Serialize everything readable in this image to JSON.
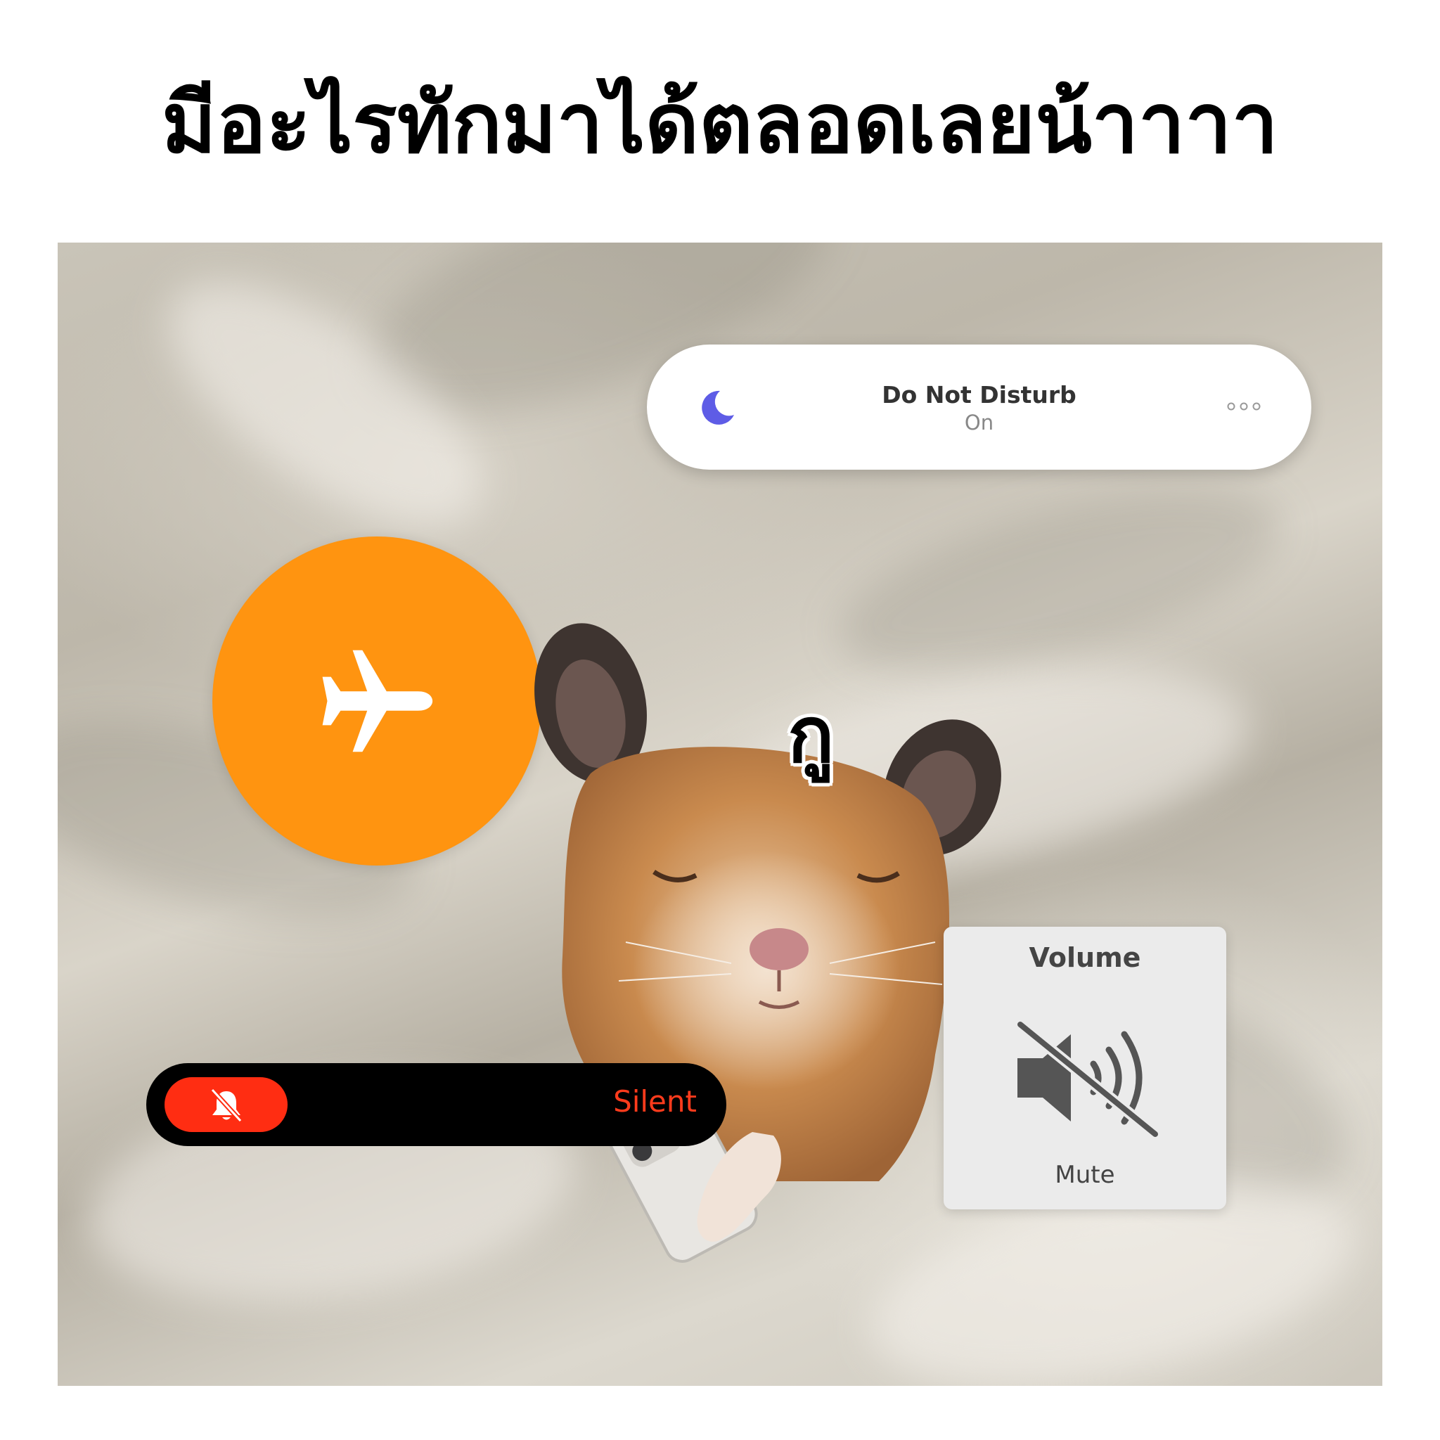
{
  "headline": "มีอะไรทักมาได้ตลอดเลยน้าาาา",
  "overlay_text": "กู",
  "dnd": {
    "title": "Do Not Disturb",
    "status": "On"
  },
  "silent": {
    "label": "Silent"
  },
  "volume": {
    "title": "Volume",
    "status": "Mute"
  },
  "colors": {
    "airplane_bg": "#ff9410",
    "silent_red": "#ff2d12",
    "moon_purple": "#5e5ce6"
  },
  "icons": [
    "moon-icon",
    "more-dots-icon",
    "airplane-icon",
    "bell-slash-icon",
    "speaker-mute-icon"
  ]
}
